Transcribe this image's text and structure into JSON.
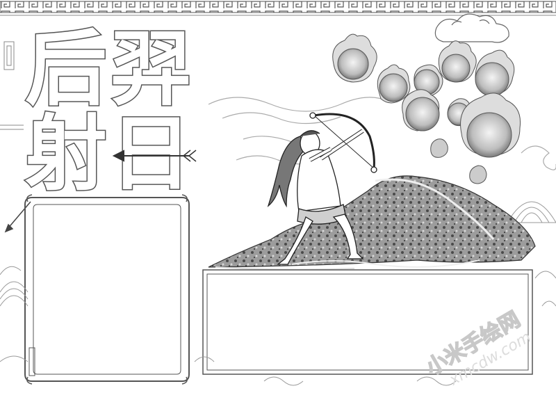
{
  "title": {
    "chars": [
      "后",
      "羿",
      "射",
      "日"
    ]
  },
  "watermark": {
    "text": "小米手绘网",
    "url": "xmcdw.com"
  },
  "panels": {
    "left_frame": "empty writing frame",
    "bottom_box": "empty writing box"
  }
}
